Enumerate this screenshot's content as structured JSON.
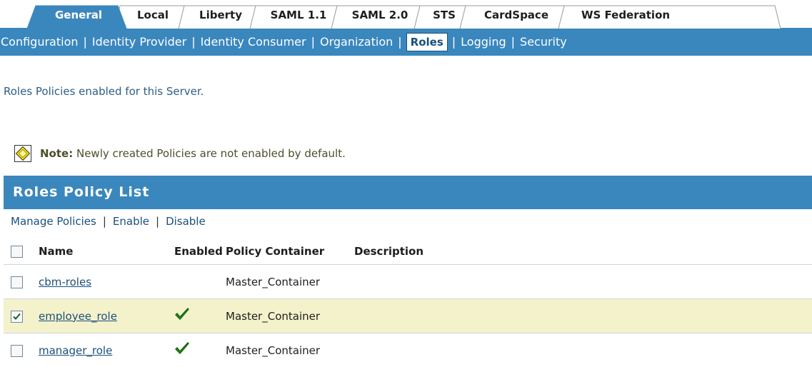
{
  "tabs": [
    {
      "label": "General",
      "active": true
    },
    {
      "label": "Local",
      "active": false
    },
    {
      "label": "Liberty",
      "active": false
    },
    {
      "label": "SAML 1.1",
      "active": false
    },
    {
      "label": "SAML 2.0",
      "active": false
    },
    {
      "label": "STS",
      "active": false
    },
    {
      "label": "CardSpace",
      "active": false
    },
    {
      "label": "WS Federation",
      "active": false
    }
  ],
  "subnav": {
    "items": [
      "Configuration",
      "Identity Provider",
      "Identity Consumer",
      "Organization",
      "Roles",
      "Logging",
      "Security"
    ],
    "active": "Roles",
    "separator": "|"
  },
  "info_text": "Roles Policies enabled for this Server.",
  "note": {
    "label": "Note:",
    "text": " Newly created Policies are not enabled by default.",
    "icon": "diamond-note-icon"
  },
  "list_title": "Roles Policy List",
  "actions": {
    "manage": "Manage Policies",
    "enable": "Enable",
    "disable": "Disable",
    "separator": "|"
  },
  "table": {
    "headers": {
      "name": "Name",
      "enabled": "Enabled",
      "container": "Policy Container",
      "description": "Description"
    },
    "rows": [
      {
        "name": "cbm-roles",
        "enabled": false,
        "container": "Master_Container",
        "description": "",
        "checked": false
      },
      {
        "name": "employee_role",
        "enabled": true,
        "container": "Master_Container",
        "description": "",
        "checked": true
      },
      {
        "name": "manager_role",
        "enabled": true,
        "container": "Master_Container",
        "description": "",
        "checked": false
      }
    ]
  },
  "colors": {
    "accent": "#3a87be",
    "active_tab": "#3a87be",
    "selected_row": "#f4f2cb",
    "check_green": "#2a8a1c",
    "link": "#1c4f7c"
  }
}
